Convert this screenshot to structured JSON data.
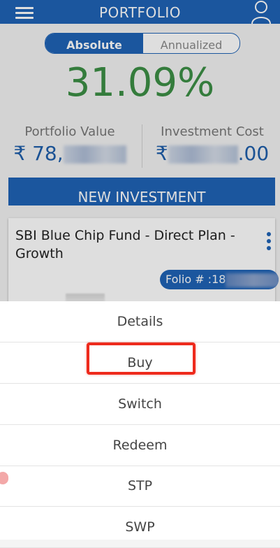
{
  "header": {
    "title": "PORTFOLIO",
    "menu_icon": "hamburger-icon",
    "user_icon": "user-icon"
  },
  "returns_toggle": {
    "active": "Absolute",
    "inactive": "Annualized"
  },
  "returns_value": "31.09%",
  "stats": {
    "portfolio_value": {
      "label": "Portfolio Value",
      "prefix": "₹ 78,",
      "suffix": ""
    },
    "investment_cost": {
      "label": "Investment Cost",
      "prefix": "₹",
      "suffix": ".00"
    }
  },
  "new_investment_label": "NEW INVESTMENT",
  "fund": {
    "name": "SBI Blue Chip Fund - Direct Plan - Growth",
    "folio": "Folio # :18"
  },
  "sheet": {
    "items": [
      "Details",
      "Buy",
      "Switch",
      "Redeem",
      "STP",
      "SWP"
    ],
    "highlighted": "Buy"
  },
  "colors": {
    "primary": "#1f63b6",
    "returns_green": "#3c8f45",
    "highlight_red": "#ee2a1c"
  }
}
